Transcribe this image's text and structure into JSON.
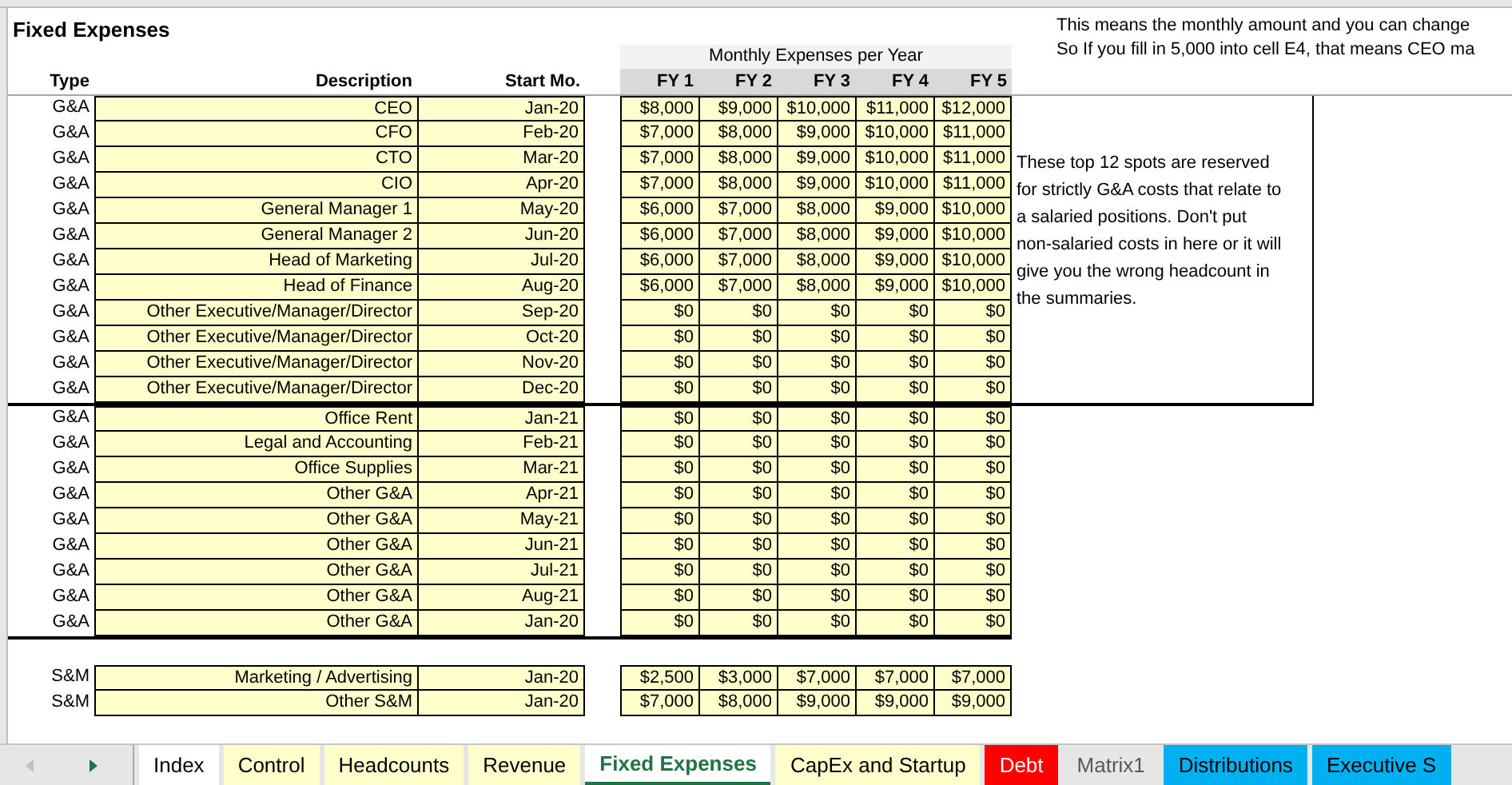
{
  "sheet": {
    "title": "Fixed Expenses",
    "group_header": "Monthly Expenses per Year",
    "columns": [
      "Type",
      "Description",
      "Start Mo.",
      "FY 1",
      "FY 2",
      "FY 3",
      "FY 4",
      "FY 5"
    ],
    "notes": [
      "This means the monthly amount and you can change",
      "So If you fill in 5,000 into cell E4, that means CEO ma"
    ],
    "sections": [
      {
        "note": "These top 12 spots are reserved for strictly G&A costs that relate to a salaried positions. Don't put non-salaried costs in here or it will give you the wrong headcount in the summaries.",
        "thick_bottom": true,
        "rows": [
          {
            "type": "G&A",
            "description": "CEO",
            "start": "Jan-20",
            "values": [
              "$8,000",
              "$9,000",
              "$10,000",
              "$11,000",
              "$12,000"
            ]
          },
          {
            "type": "G&A",
            "description": "CFO",
            "start": "Feb-20",
            "values": [
              "$7,000",
              "$8,000",
              "$9,000",
              "$10,000",
              "$11,000"
            ]
          },
          {
            "type": "G&A",
            "description": "CTO",
            "start": "Mar-20",
            "values": [
              "$7,000",
              "$8,000",
              "$9,000",
              "$10,000",
              "$11,000"
            ]
          },
          {
            "type": "G&A",
            "description": "CIO",
            "start": "Apr-20",
            "values": [
              "$7,000",
              "$8,000",
              "$9,000",
              "$10,000",
              "$11,000"
            ]
          },
          {
            "type": "G&A",
            "description": "General Manager 1",
            "start": "May-20",
            "values": [
              "$6,000",
              "$7,000",
              "$8,000",
              "$9,000",
              "$10,000"
            ]
          },
          {
            "type": "G&A",
            "description": "General Manager 2",
            "start": "Jun-20",
            "values": [
              "$6,000",
              "$7,000",
              "$8,000",
              "$9,000",
              "$10,000"
            ]
          },
          {
            "type": "G&A",
            "description": "Head of Marketing",
            "start": "Jul-20",
            "values": [
              "$6,000",
              "$7,000",
              "$8,000",
              "$9,000",
              "$10,000"
            ]
          },
          {
            "type": "G&A",
            "description": "Head of Finance",
            "start": "Aug-20",
            "values": [
              "$6,000",
              "$7,000",
              "$8,000",
              "$9,000",
              "$10,000"
            ]
          },
          {
            "type": "G&A",
            "description": "Other Executive/Manager/Director",
            "start": "Sep-20",
            "values": [
              "$0",
              "$0",
              "$0",
              "$0",
              "$0"
            ]
          },
          {
            "type": "G&A",
            "description": "Other Executive/Manager/Director",
            "start": "Oct-20",
            "values": [
              "$0",
              "$0",
              "$0",
              "$0",
              "$0"
            ]
          },
          {
            "type": "G&A",
            "description": "Other Executive/Manager/Director",
            "start": "Nov-20",
            "values": [
              "$0",
              "$0",
              "$0",
              "$0",
              "$0"
            ]
          },
          {
            "type": "G&A",
            "description": "Other Executive/Manager/Director",
            "start": "Dec-20",
            "values": [
              "$0",
              "$0",
              "$0",
              "$0",
              "$0"
            ]
          }
        ]
      },
      {
        "thick_bottom": true,
        "rows": [
          {
            "type": "G&A",
            "description": "Office Rent",
            "start": "Jan-21",
            "values": [
              "$0",
              "$0",
              "$0",
              "$0",
              "$0"
            ]
          },
          {
            "type": "G&A",
            "description": "Legal and Accounting",
            "start": "Feb-21",
            "values": [
              "$0",
              "$0",
              "$0",
              "$0",
              "$0"
            ]
          },
          {
            "type": "G&A",
            "description": "Office Supplies",
            "start": "Mar-21",
            "values": [
              "$0",
              "$0",
              "$0",
              "$0",
              "$0"
            ]
          },
          {
            "type": "G&A",
            "description": "Other G&A",
            "start": "Apr-21",
            "values": [
              "$0",
              "$0",
              "$0",
              "$0",
              "$0"
            ]
          },
          {
            "type": "G&A",
            "description": "Other G&A",
            "start": "May-21",
            "values": [
              "$0",
              "$0",
              "$0",
              "$0",
              "$0"
            ]
          },
          {
            "type": "G&A",
            "description": "Other G&A",
            "start": "Jun-21",
            "values": [
              "$0",
              "$0",
              "$0",
              "$0",
              "$0"
            ]
          },
          {
            "type": "G&A",
            "description": "Other G&A",
            "start": "Jul-21",
            "values": [
              "$0",
              "$0",
              "$0",
              "$0",
              "$0"
            ]
          },
          {
            "type": "G&A",
            "description": "Other G&A",
            "start": "Aug-21",
            "values": [
              "$0",
              "$0",
              "$0",
              "$0",
              "$0"
            ]
          },
          {
            "type": "G&A",
            "description": "Other G&A",
            "start": "Jan-20",
            "values": [
              "$0",
              "$0",
              "$0",
              "$0",
              "$0"
            ]
          }
        ]
      },
      {
        "thick_bottom": false,
        "rows": [
          {
            "type": "S&M",
            "description": "Marketing / Advertising",
            "start": "Jan-20",
            "values": [
              "$2,500",
              "$3,000",
              "$7,000",
              "$7,000",
              "$7,000"
            ]
          },
          {
            "type": "S&M",
            "description": "Other S&M",
            "start": "Jan-20",
            "values": [
              "$7,000",
              "$8,000",
              "$9,000",
              "$9,000",
              "$9,000"
            ]
          }
        ]
      }
    ]
  },
  "tabs": [
    {
      "label": "Index",
      "selected": false,
      "color": "#ffffff",
      "dimmed": false
    },
    {
      "label": "Control",
      "selected": false,
      "color": "#ffffcc",
      "dimmed": false
    },
    {
      "label": "Headcounts",
      "selected": false,
      "color": "#ffffcc",
      "dimmed": false
    },
    {
      "label": "Revenue",
      "selected": false,
      "color": "#ffffcc",
      "dimmed": false
    },
    {
      "label": "Fixed Expenses",
      "selected": true,
      "color": "#ffffff",
      "dimmed": false
    },
    {
      "label": "CapEx and Startup",
      "selected": false,
      "color": "#ffffcc",
      "dimmed": false
    },
    {
      "label": "Debt",
      "selected": false,
      "color": "#ff0000",
      "dimmed": false
    },
    {
      "label": "Matrix1",
      "selected": false,
      "color": "#e6e6e6",
      "dimmed": true
    },
    {
      "label": "Distributions",
      "selected": false,
      "color": "#00b0f0",
      "dimmed": false
    },
    {
      "label": "Executive S",
      "selected": false,
      "color": "#00b0f0",
      "dimmed": false
    }
  ]
}
